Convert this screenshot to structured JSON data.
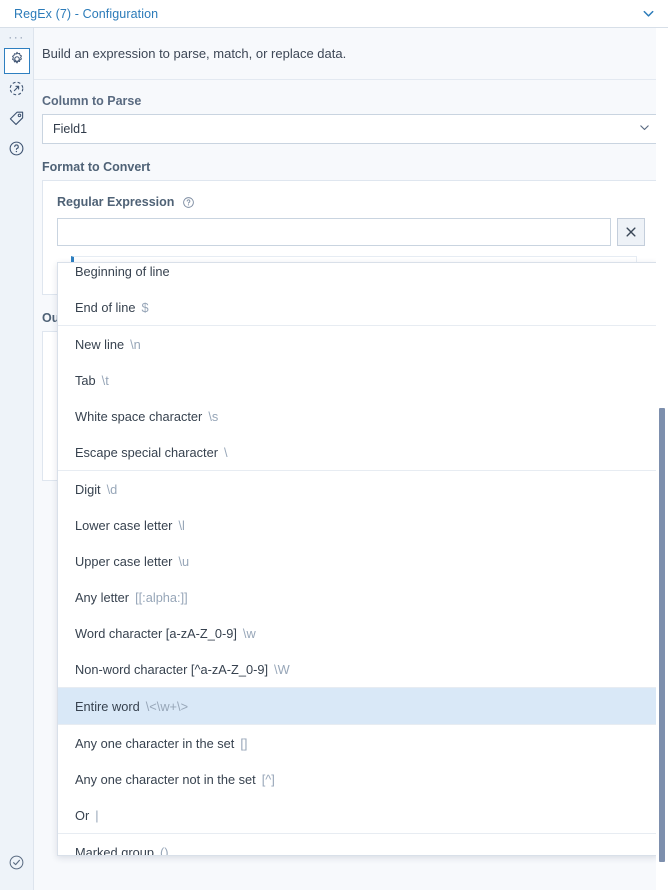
{
  "window": {
    "title": "RegEx (7) - Configuration",
    "collapse_icon": "chevron-down-icon"
  },
  "rail": {
    "drag_handle": "···",
    "items": [
      {
        "icon": "gear-icon",
        "name": "configuration",
        "selected": true
      },
      {
        "icon": "runtime-arrow-icon",
        "name": "runtime",
        "selected": false
      },
      {
        "icon": "tag-icon",
        "name": "annotation",
        "selected": false
      },
      {
        "icon": "question-circle-icon",
        "name": "help",
        "selected": false
      }
    ],
    "bottom": {
      "icon": "check-circle-icon",
      "name": "status-valid"
    }
  },
  "main": {
    "description": "Build an expression to parse, match, or replace data.",
    "column_to_parse": {
      "label": "Column to Parse",
      "value": "Field1",
      "dropdown_icon": "chevron-down-icon"
    },
    "format_to_convert": {
      "label": "Format to Convert"
    },
    "regular_expression": {
      "label": "Regular Expression",
      "help_icon": "question-circle-icon",
      "value": "",
      "placeholder": "",
      "clear_icon": "close-x-icon",
      "clear_label": "✕"
    },
    "output_method": {
      "label": "Ou"
    }
  },
  "dropdown": {
    "items": [
      {
        "label": "Beginning of line",
        "token": "",
        "selected": false,
        "separator_after": false
      },
      {
        "label": "End of line",
        "token": "$",
        "selected": false,
        "separator_after": true
      },
      {
        "label": "New line",
        "token": "\\n",
        "selected": false,
        "separator_after": false
      },
      {
        "label": "Tab",
        "token": "\\t",
        "selected": false,
        "separator_after": false
      },
      {
        "label": "White space character",
        "token": "\\s",
        "selected": false,
        "separator_after": false
      },
      {
        "label": "Escape special character",
        "token": "\\",
        "selected": false,
        "separator_after": true
      },
      {
        "label": "Digit",
        "token": "\\d",
        "selected": false,
        "separator_after": false
      },
      {
        "label": "Lower case letter",
        "token": "\\l",
        "selected": false,
        "separator_after": false
      },
      {
        "label": "Upper case letter",
        "token": "\\u",
        "selected": false,
        "separator_after": false
      },
      {
        "label": "Any letter",
        "token": "[[:alpha:]]",
        "selected": false,
        "separator_after": false
      },
      {
        "label": "Word character [a-zA-Z_0-9]",
        "token": "\\w",
        "selected": false,
        "separator_after": false
      },
      {
        "label": "Non-word character [^a-zA-Z_0-9]",
        "token": "\\W",
        "selected": false,
        "separator_after": true
      },
      {
        "label": "Entire word",
        "token": "\\<\\w+\\>",
        "selected": true,
        "separator_after": true
      },
      {
        "label": "Any one character in the set",
        "token": "[]",
        "selected": false,
        "separator_after": false
      },
      {
        "label": "Any one character not in the set",
        "token": "[^]",
        "selected": false,
        "separator_after": false
      },
      {
        "label": "Or",
        "token": "|",
        "selected": false,
        "separator_after": true
      },
      {
        "label": "Marked group",
        "token": "()",
        "selected": false,
        "separator_after": false
      }
    ]
  },
  "colors": {
    "accent": "#2b7bb9",
    "selection": "#d9e8f7",
    "token": "#97a6b8",
    "background": "#f7f9fc",
    "rail": "#eef3f9"
  }
}
